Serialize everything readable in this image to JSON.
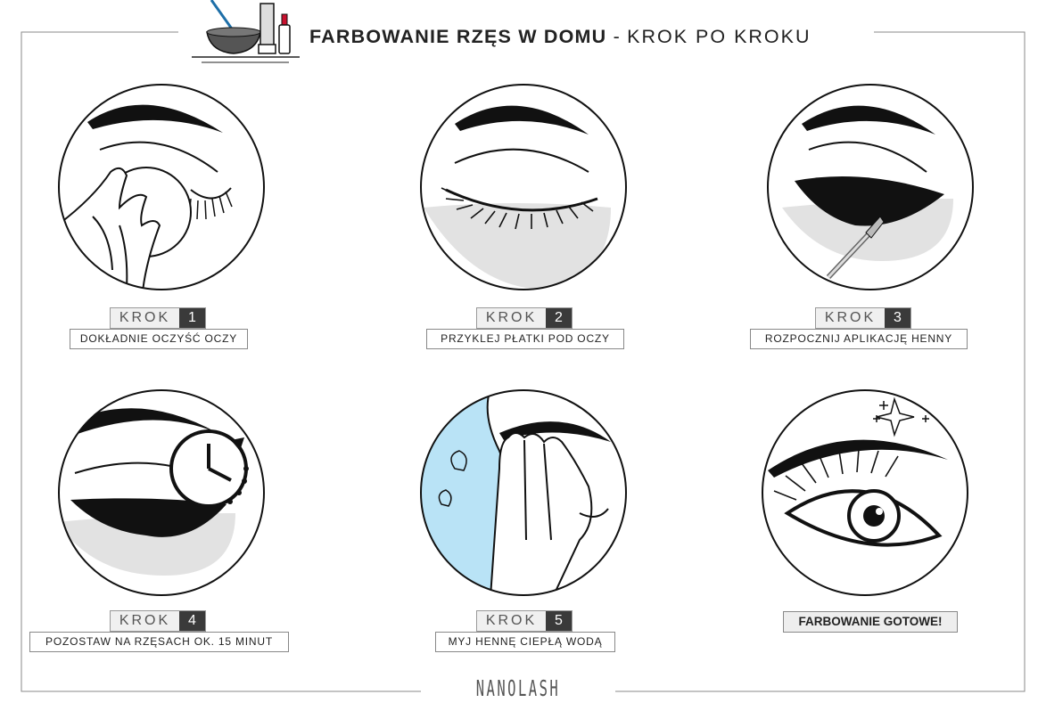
{
  "header": {
    "title_bold": "FARBOWANIE RZĘS W DOMU",
    "separator": "-",
    "title_light": "KROK PO KROKU"
  },
  "steps": [
    {
      "krok": "KROK",
      "number": "1",
      "text": "DOKŁADNIE OCZYŚĆ OCZY"
    },
    {
      "krok": "KROK",
      "number": "2",
      "text": "PRZYKLEJ PŁATKI POD OCZY"
    },
    {
      "krok": "KROK",
      "number": "3",
      "text": "ROZPOCZNIJ APLIKACJĘ HENNY"
    },
    {
      "krok": "KROK",
      "number": "4",
      "text": "POZOSTAW NA RZĘSACH OK. 15 MINUT"
    },
    {
      "krok": "KROK",
      "number": "5",
      "text": "MYJ HENNĘ CIEPŁĄ WODĄ"
    }
  ],
  "final": {
    "text": "FARBOWANIE GOTOWE!"
  },
  "footer": {
    "logo": "NANOLASH"
  },
  "colors": {
    "ink": "#111111",
    "pad": "#e2e2e2",
    "water": "#b9e3f6",
    "frame": "#888888"
  }
}
